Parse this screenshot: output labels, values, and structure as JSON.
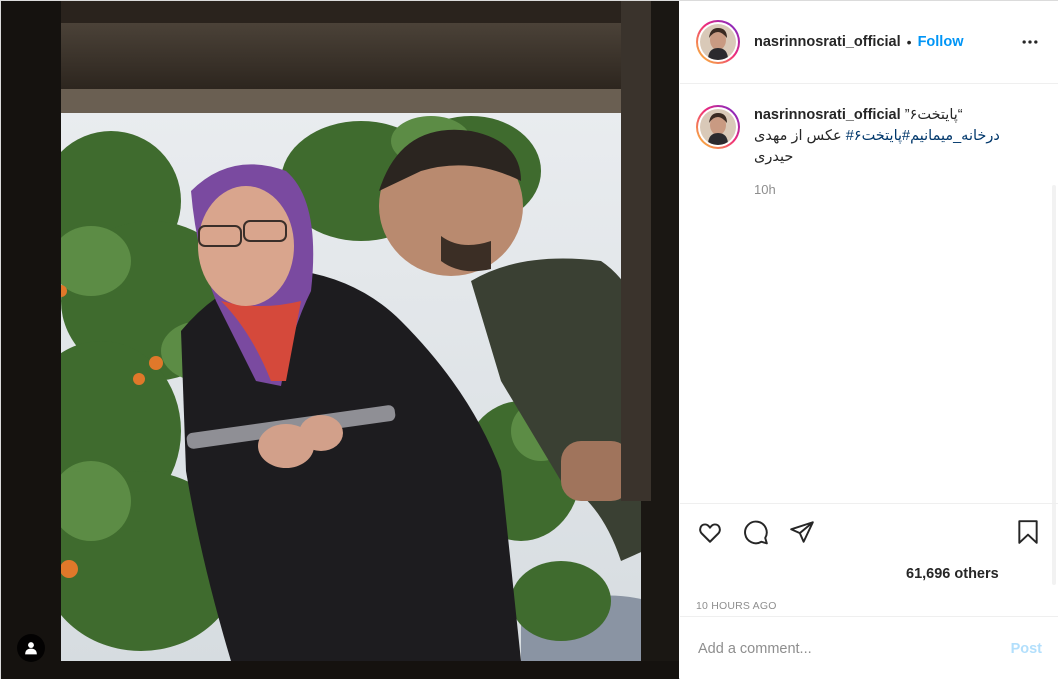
{
  "post": {
    "username": "nasrinnosrati_official",
    "header_separator": "•",
    "follow_label": "Follow",
    "more_icon": "more-options-icon"
  },
  "caption": {
    "username": "nasrinnosrati_official",
    "line1": "“پایتخت۶”",
    "line2_hashtag1": "درخانه_میمانیم#",
    "line2_hashtag2": "پایتخت۶#",
    "line2_text": " عکس از مهدی",
    "line3": "حیدری",
    "time": "10h"
  },
  "actions": {
    "like_icon": "heart-icon",
    "comment_icon": "comment-icon",
    "share_icon": "share-icon",
    "save_icon": "bookmark-icon",
    "likes_text": "61,696 others",
    "timestamp": "10 HOURS AGO"
  },
  "comment": {
    "placeholder": "Add a comment...",
    "post_label": "Post"
  },
  "colors": {
    "accent": "#0095f6",
    "hashtag": "#00376b",
    "muted": "#8e8e8e",
    "post_disabled": "#b2dffc"
  }
}
